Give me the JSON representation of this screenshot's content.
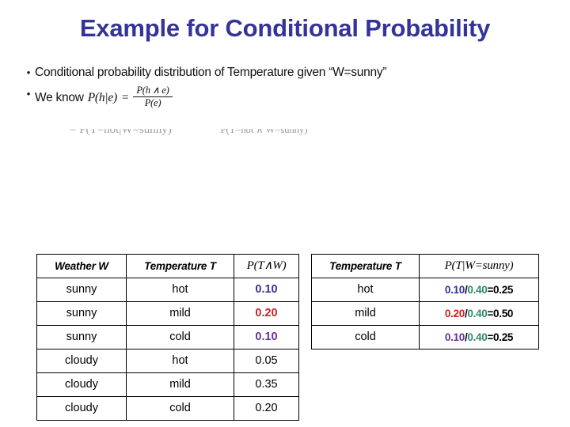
{
  "slide": {
    "title": "Example for Conditional Probability"
  },
  "bullets": [
    {
      "marker": "•",
      "text": "Conditional probability distribution of Temperature given “W=sunny”"
    },
    {
      "marker": "•",
      "lead": "We know",
      "lhs": "P(h|e)",
      "equals": "=",
      "numerator": "P(h ∧ e)",
      "denominator": "P(e)"
    }
  ],
  "clipped_derivation": {
    "visible_fragment": "= P(T=hot|W=sunny)",
    "tail_fragment": "P(T=hot ∧ W=sunny)"
  },
  "joint_table": {
    "headers": [
      "Weather W",
      "Temperature T",
      "P(T∧W)"
    ],
    "rows": [
      {
        "weather": "sunny",
        "temperature": "hot",
        "prob": "0.10",
        "prob_color": "navy"
      },
      {
        "weather": "sunny",
        "temperature": "mild",
        "prob": "0.20",
        "prob_color": "red"
      },
      {
        "weather": "sunny",
        "temperature": "cold",
        "prob": "0.10",
        "prob_color": "purple"
      },
      {
        "weather": "cloudy",
        "temperature": "hot",
        "prob": "0.05",
        "prob_color": "black"
      },
      {
        "weather": "cloudy",
        "temperature": "mild",
        "prob": "0.35",
        "prob_color": "black"
      },
      {
        "weather": "cloudy",
        "temperature": "cold",
        "prob": "0.20",
        "prob_color": "black"
      }
    ]
  },
  "conditional_table": {
    "headers": [
      "Temperature T",
      "P(T|W=sunny)"
    ],
    "rows": [
      {
        "temperature": "hot",
        "numerator": "0.10",
        "numerator_color": "navy",
        "slash": "/",
        "denominator": "0.40",
        "result": "=0.25"
      },
      {
        "temperature": "mild",
        "numerator": "0.20",
        "numerator_color": "red",
        "slash": "/",
        "denominator": "0.40",
        "result": "=0.50"
      },
      {
        "temperature": "cold",
        "numerator": "0.10",
        "numerator_color": "purple",
        "slash": "/",
        "denominator": "0.40",
        "result": "=0.25"
      }
    ]
  },
  "colors": {
    "title": "#333399",
    "navy": "#333399",
    "red": "#CC2222",
    "purple": "#663399",
    "green": "#2E8B6B",
    "black": "#000000"
  }
}
